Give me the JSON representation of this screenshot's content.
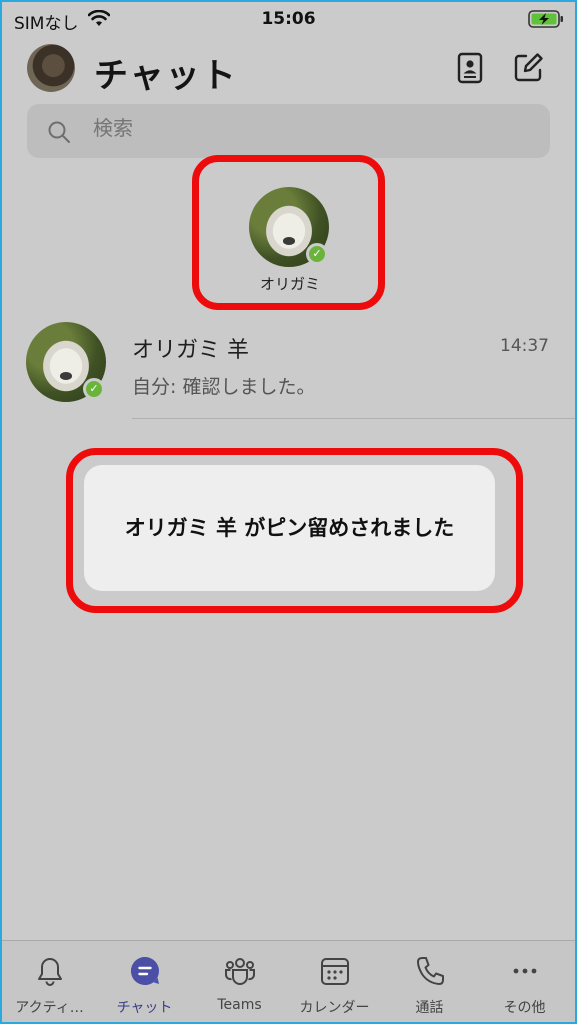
{
  "status_bar": {
    "carrier": "SIMなし",
    "time": "15:06"
  },
  "header": {
    "title": "チャット"
  },
  "search": {
    "placeholder": "検索"
  },
  "pinned": {
    "name": "オリガミ"
  },
  "chats": [
    {
      "name": "オリガミ 羊",
      "time": "14:37",
      "preview": "自分: 確認しました。"
    }
  ],
  "toast": {
    "message": "オリガミ 羊 がピン留めされました"
  },
  "tabs": [
    {
      "label": "アクティ…",
      "icon": "bell-icon"
    },
    {
      "label": "チャット",
      "icon": "chat-icon"
    },
    {
      "label": "Teams",
      "icon": "teams-icon"
    },
    {
      "label": "カレンダー",
      "icon": "calendar-icon"
    },
    {
      "label": "通話",
      "icon": "phone-icon"
    },
    {
      "label": "その他",
      "icon": "more-icon"
    }
  ],
  "colors": {
    "highlight": "#ee0b0b",
    "presence": "#6bb43b",
    "active_tab": "#4b4fa6",
    "background": "#cbcbcb"
  }
}
